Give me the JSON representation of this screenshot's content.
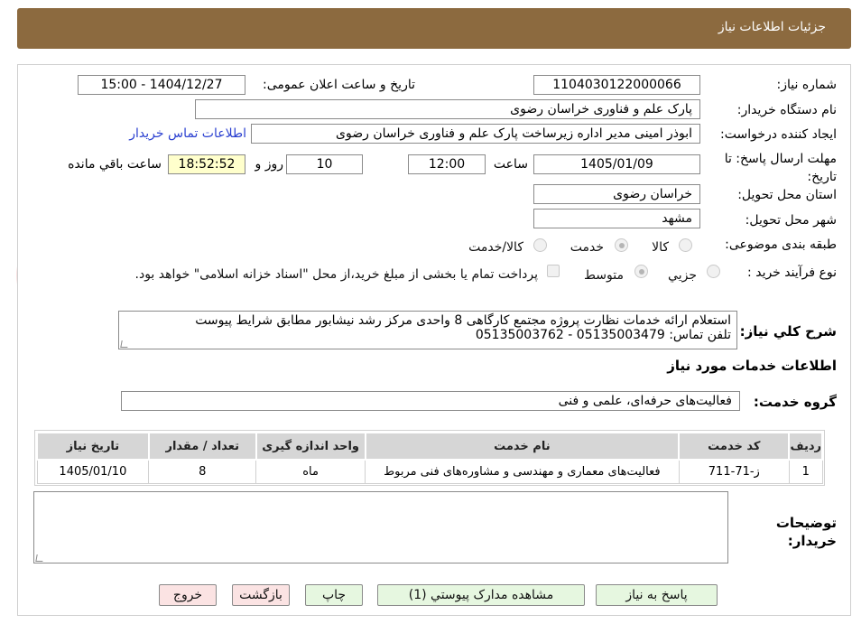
{
  "header": {
    "title": "جزئیات اطلاعات نیاز"
  },
  "form": {
    "need_number_label": "شماره نیاز:",
    "need_number": "1104030122000066",
    "announce_label": "تاریخ و ساعت اعلان عمومی:",
    "announce_value": "1404/12/27 - 15:00",
    "buyer_org_label": "نام دستگاه خریدار:",
    "buyer_org": "پارک علم و فناوری خراسان رضوی",
    "requester_label": "ایجاد کننده درخواست:",
    "requester": "ابوذر امینی مدیر اداره زیرساخت پارک علم و فناوری خراسان رضوی",
    "contact_link": "اطلاعات تماس خریدار",
    "deadline_label": "مهلت ارسال پاسخ: تا تاریخ:",
    "deadline_date": "1405/01/09",
    "time_label": "ساعت",
    "deadline_time": "12:00",
    "days_value": "10",
    "days_label": "روز و",
    "remaining_time": "18:52:52",
    "remaining_label": "ساعت باقي مانده",
    "province_label": "استان محل تحویل:",
    "province": "خراسان رضوی",
    "city_label": "شهر محل تحویل:",
    "city": "مشهد",
    "category_label": "طبقه بندی موضوعی:",
    "category_options": [
      "کالا",
      "خدمت",
      "کالا/خدمت"
    ],
    "process_label": "نوع فرآیند خرید :",
    "process_options": [
      "جزیي",
      "متوسط"
    ],
    "payment_note": "پرداخت تمام یا بخشی از مبلغ خرید،از محل \"اسناد خزانه اسلامی\" خواهد بود.",
    "description_label": "شرح کلي نياز:",
    "description_line1": "استعلام ارائه خدمات نظارت پروژه مجتمع کارگاهی 8 واحدی مرکز رشد نیشابور مطابق شرایط پیوست",
    "description_line2": "تلفن تماس: 05135003479 - 05135003762",
    "services_title": "اطلاعات خدمات مورد نياز",
    "service_group_label": "گروه خدمت:",
    "service_group": "فعالیت‌های حرفه‌ای، علمی و فنی",
    "buyer_notes_label": "توضیحات خریدار:"
  },
  "table": {
    "headers": [
      "ردیف",
      "کد خدمت",
      "نام خدمت",
      "واحد اندازه گیری",
      "تعداد / مقدار",
      "تاریخ نیاز"
    ],
    "rows": [
      [
        "1",
        "ز-71-711",
        "فعالیت‌های معماری و مهندسی و مشاوره‌های فنی مربوط",
        "ماه",
        "8",
        "1405/01/10"
      ]
    ]
  },
  "buttons": {
    "reply": "پاسخ به نیاز",
    "attachments": "مشاهده مدارک پیوستي (1)",
    "print": "چاپ",
    "back": "بازگشت",
    "exit": "خروج"
  },
  "colors": {
    "header_bg": "#8c6a3f",
    "link": "#2a3fd0",
    "remaining_bg": "#ffffcc",
    "table_header_bg": "#d6d6d6"
  }
}
